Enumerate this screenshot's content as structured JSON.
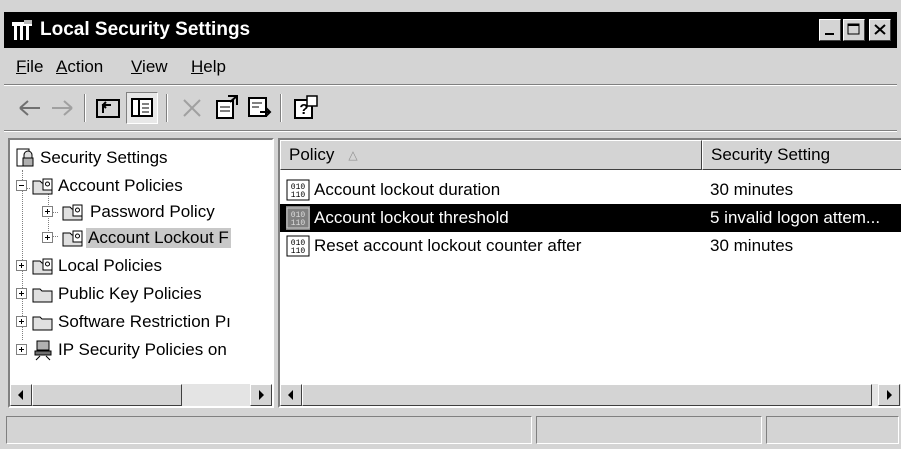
{
  "window": {
    "title": "Local Security Settings",
    "icon": "security-settings-icon"
  },
  "menu": [
    {
      "label": "File"
    },
    {
      "label": "Action"
    },
    {
      "label": "View"
    },
    {
      "label": "Help"
    }
  ],
  "toolbar": {
    "buttons": [
      "back-arrow-icon",
      "forward-arrow-icon",
      "up-one-level-icon",
      "show-hide-tree-icon",
      "delete-icon",
      "properties-icon",
      "export-list-icon",
      "help-icon"
    ]
  },
  "tree": {
    "root": "Security Settings",
    "nodes": [
      {
        "label": "Account Policies"
      },
      {
        "label": "Password Policy"
      },
      {
        "label": "Account Lockout F"
      },
      {
        "label": "Local Policies"
      },
      {
        "label": "Public Key Policies"
      },
      {
        "label": "Software Restriction Pı"
      },
      {
        "label": "IP Security Policies on"
      }
    ]
  },
  "list": {
    "columns": [
      "Policy",
      "Security Setting"
    ],
    "sort_indicator": "△",
    "rows": [
      {
        "policy": "Account lockout duration",
        "setting": "30 minutes"
      },
      {
        "policy": "Account lockout threshold",
        "setting": "5 invalid logon attem..."
      },
      {
        "policy": "Reset account lockout counter after",
        "setting": "30 minutes"
      }
    ]
  },
  "colors": {
    "selection": "#000000",
    "face": "#d4d4d4"
  }
}
